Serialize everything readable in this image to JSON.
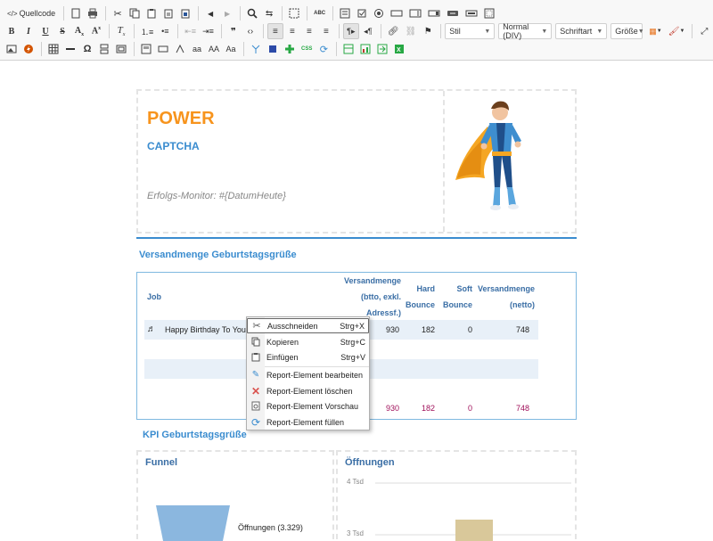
{
  "toolbar": {
    "source_label": "Quellcode",
    "styles_combo": "Stil",
    "format_combo": "Normal (DIV)",
    "font_combo": "Schriftart",
    "size_combo": "Größe",
    "bold": "B",
    "italic": "I",
    "underline": "U",
    "strike": "S",
    "aa_lower": "aa",
    "aa_upper": "AA",
    "aa_mixed": "Aa",
    "omega": "Ω",
    "quote": "❞",
    "code": "‹›"
  },
  "report": {
    "title": "POWER",
    "subtitle": "CAPTCHA",
    "monitor": "Erfolgs-Monitor:  #{DatumHeute}",
    "section1": "Versandmenge Geburtstagsgrüße",
    "section2": "KPI Geburtstagsgrüße",
    "table": {
      "col_job": "Job",
      "col_versand_1": "Versandmenge",
      "col_versand_2": "(btto, exkl.",
      "col_versand_3": "Adressf.)",
      "col_hard_1": "Hard",
      "col_hard_2": "Bounce",
      "col_soft_1": "Soft",
      "col_soft_2": "Bounce",
      "col_netto_1": "Versandmenge",
      "col_netto_2": "(netto)",
      "row1_job": "Happy Birthday To You",
      "row1_versand": "930",
      "row1_hard": "182",
      "row1_soft": "0",
      "row1_netto": "748",
      "tot_versand": "930",
      "tot_hard": "182",
      "tot_soft": "0",
      "tot_netto": "748"
    },
    "funnel_title": "Funnel",
    "funnel_label": "Öffnungen (3.329)",
    "opens_title": "Öffnungen",
    "opens_tick_4": "4 Tsd",
    "opens_tick_3": "3 Tsd"
  },
  "context_menu": {
    "cut": "Ausschneiden",
    "cut_key": "Strg+X",
    "copy": "Kopieren",
    "copy_key": "Strg+C",
    "paste": "Einfügen",
    "paste_key": "Strg+V",
    "edit": "Report-Element bearbeiten",
    "delete": "Report-Element löschen",
    "preview": "Report-Element Vorschau",
    "fill": "Report-Element füllen"
  }
}
